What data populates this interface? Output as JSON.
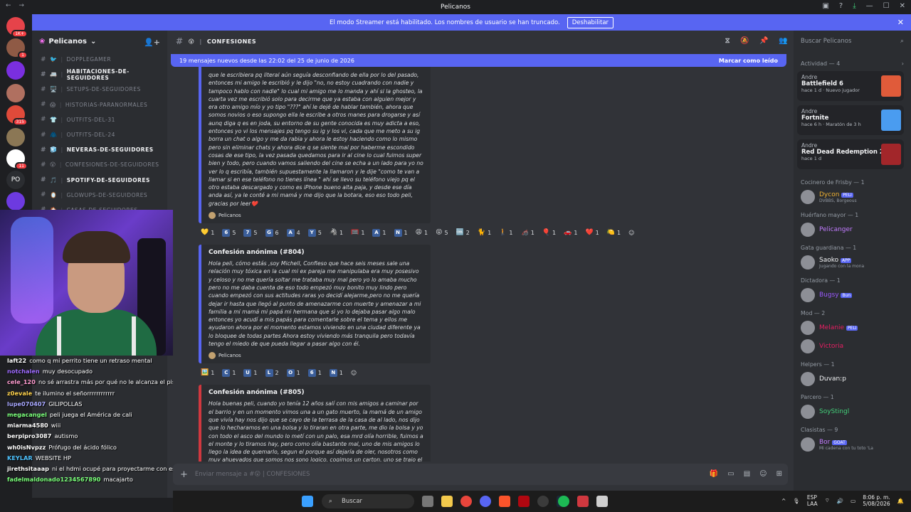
{
  "window": {
    "title": "Pelicanos"
  },
  "banner": {
    "text": "El modo Streamer está habilitado. Los nombres de usuario se han truncado.",
    "button": "Deshabilitar"
  },
  "servers": [
    {
      "label": "",
      "badge": "1K+",
      "color": "#e6434a"
    },
    {
      "label": "",
      "badge": "1",
      "color": "#8f5a45"
    },
    {
      "label": "",
      "badge": "",
      "color": "#7a2fe0"
    },
    {
      "label": "",
      "badge": "",
      "color": "#b07060"
    },
    {
      "label": "",
      "badge": "315",
      "color": "#e04a3a"
    },
    {
      "label": "",
      "badge": "",
      "color": "#8b7755"
    },
    {
      "label": "",
      "badge": "11",
      "color": "#ffffff"
    },
    {
      "label": "PO",
      "badge": "",
      "color": "#2b2d31"
    },
    {
      "label": "",
      "badge": "",
      "color": "#6d3ae0"
    }
  ],
  "guild": {
    "name": "Pelicanos"
  },
  "channels": [
    {
      "emoji": "🐦",
      "name": "DOPPLEGAMER",
      "unread": false
    },
    {
      "emoji": "🚐",
      "name": "HABITACIONES-DE-SEGUIDORES",
      "unread": true
    },
    {
      "emoji": "🖥️",
      "name": "SETUPS-DE-SEGUIDORES",
      "unread": false
    },
    {
      "emoji": "😱",
      "name": "HISTORIAS-PARANORMALES",
      "unread": false
    },
    {
      "emoji": "👕",
      "name": "OUTFITS-DEL-31",
      "unread": false
    },
    {
      "emoji": "🧥",
      "name": "OUTFITS-DEL-24",
      "unread": false
    },
    {
      "emoji": "🧊",
      "name": "NEVERAS-DE-SEGUIDORES",
      "unread": true
    },
    {
      "emoji": "😲",
      "name": "CONFESIONES-DE-SEGUIDORES",
      "unread": false
    },
    {
      "emoji": "🎵",
      "name": "SPOTIFY-DE-SEGUIDORES",
      "unread": true
    },
    {
      "emoji": "🪞",
      "name": "GLOWUPS-DE-SEGUIDORES",
      "unread": false
    },
    {
      "emoji": "🏠",
      "name": "CASAS-DE-SEGUIDORES",
      "unread": false
    }
  ],
  "chat_overlay": [
    {
      "user": "laft22",
      "color": "#ffffff",
      "text": "como q mi perrito tiene un retraso mental"
    },
    {
      "user": "notchalen",
      "color": "#9e6bff",
      "text": "muy desocupado"
    },
    {
      "user": "cele_120",
      "color": "#ff9cd0",
      "text": "no sé arrastra más por qué no le alcanza el piso"
    },
    {
      "user": "z0evale",
      "color": "#ffd34d",
      "text": "te ilumino el señorrrrrrrrrrrr"
    },
    {
      "user": "lupe070407",
      "color": "#a8a8ff",
      "text": "GILIPOLLAS"
    },
    {
      "user": "megacangel",
      "color": "#7bff7b",
      "text": "peli juega el América de cali"
    },
    {
      "user": "miarma4580",
      "color": "#ffffff",
      "text": "wiii"
    },
    {
      "user": "berpipro3087",
      "color": "#ffffff",
      "text": "autismo"
    },
    {
      "user": "wh0isNvpzz",
      "color": "#ffffff",
      "text": "Prófugo del ácido fólico"
    },
    {
      "user": "KEYLAR",
      "color": "#4fc3ff",
      "text": "WEBSITE HP"
    },
    {
      "user": "jirethsitaaap",
      "color": "#ffffff",
      "text": "ni el hdmi ocupé para proyectarme con esa JAJAJAJ"
    },
    {
      "user": "fadelmaldonado1234567890",
      "color": "#7bff7b",
      "text": "macajarto"
    }
  ],
  "channel": {
    "emoji": "😲",
    "name": "CONFESIONES"
  },
  "newbar": {
    "text": "19 mensajes nuevos desde las 22:02 del 25 de junio de 2026",
    "action": "Marcar como leído"
  },
  "embeds": [
    {
      "title": "",
      "body": "que le escribiera pq literal aún seguía desconfiando de ella por lo del pasado, entonces mi amigo le escribió y le dijo \"no, no estoy cuadrando con nadie y tampoco hablo con nadie\" lo cual mi amigo me lo manda y ahí si la ghosteo, la cuarta vez me escribió solo para decirme que ya estaba con alguien mejor y era otro amigo mío y yo tipo \"???\" ahí le dejé de hablar también, ahora que somos novios o eso supongo ella le escribe a otros manes para drogarse y así aunq diga q es en joda, su entorno de su gente conocida es muy adicta a eso, entonces yo vi los mensajes pq tengo su ig y los vi, cada que me meto a su ig borra un chat o algo y me da rabia y ahora le estoy haciendo como lo mismo pero sin eliminar chats y ahora dice q se siente mal por haberme escondido cosas de ese tipo, la vez pasada quedamos para ir al cine lo cual fuimos super bien y todo, pero cuando vamos saliendo del cine se echa a un lado para yo no ver lo q escribía, también supuestamente la llamaron y le dije \"como te van a llamar si en ese teléfono no tienes línea \" ahí se llevo su teléfono viejo pq el otro estaba descargado y como es iPhone bueno alta paja, y desde ese día anda así, ya le conté a mi mamá y me dijo que la botara, eso eso todo peli, gracias por leer❤️",
      "footer": "Pelicanos",
      "red": false
    },
    {
      "title": "Confesión anónima (#804)",
      "body": "Hola peli, cómo estás ,soy Michell, Confieso que hace seis meses sale una relación muy tóxica en la cual mi ex pareja me manipulaba era muy posesivo y celoso y no me quería soltar me trataba muy mal pero yo lo amaba mucho pero no me daba cuenta de eso todo empezó muy bonito muy lindo pero cuando empezó con sus actitudes raras yo decidí alejarme,pero no me quería dejar ir hasta que llegó al punto de amenazarme con muerte y amenazar a mi familia a mi mamá mi papá mi hermana que si yo lo dejaba pasar algo malo entonces yo acudí a mis papás para comentarle sobre el tema y ellos me ayudaron ahora por el momento estamos viviendo en una ciudad diferente ya lo bloquee de todas partes Ahora estoy viviendo más tranquila pero todavía tengo el miedo de que pueda llegar a pasar algo con él.",
      "footer": "Pelicanos",
      "red": false
    },
    {
      "title": "Confesión anónima (#805)",
      "body": "Hola buenas peli, cuando yo tenía 12 años salí con mis amigos a caminar por el barrio y en un momento vimos una a un gato muerto, la mamá de un amigo que vivía hay nos dijo que se cayo de la terrasa de la casa de al lado, nos dijo que lo hecharamos en una bolsa y lo tiraran en otra parte, me dio la bolsa y yo con todo el asco del mundo lo metí con un palo, esa mrd olía horrible, fuimos a el monte y lo tiramos hay, pero como olía bastante mal, uno de mis amigos lo llego la idea de quemarlo, segun el porque así dejaría de oler, nosotros como muy ahuevados que somos nos sono logico, cogimos un carton, uno se trajo el encendedor he",
      "footer": "",
      "red": true
    }
  ],
  "reactions_1": [
    {
      "e": "💛",
      "n": "1"
    },
    {
      "b": "6",
      "n": "5"
    },
    {
      "b": "7",
      "n": "5"
    },
    {
      "b": "G",
      "n": "6"
    },
    {
      "b": "A",
      "n": "4"
    },
    {
      "b": "Y",
      "n": "5"
    },
    {
      "e": "🦓",
      "n": "1"
    },
    {
      "e": "🥅",
      "n": "1"
    },
    {
      "b": "A",
      "n": "1"
    },
    {
      "b": "N",
      "n": "1"
    },
    {
      "e": "😩",
      "n": "1"
    },
    {
      "e": "😝",
      "n": "5"
    },
    {
      "e": "🆒",
      "n": "2"
    },
    {
      "e": "🐈",
      "n": "1"
    },
    {
      "e": "🚶",
      "n": "1"
    },
    {
      "e": "🦽",
      "n": "1"
    },
    {
      "e": "🎈",
      "n": "1"
    },
    {
      "e": "🚗",
      "n": "1"
    },
    {
      "e": "❤️",
      "n": "1"
    },
    {
      "e": "🍋",
      "n": "1"
    }
  ],
  "reactions_2": [
    {
      "e": "🖼️",
      "n": "1"
    },
    {
      "b": "C",
      "n": "1"
    },
    {
      "b": "U",
      "n": "1"
    },
    {
      "b": "L",
      "n": "2"
    },
    {
      "b": "O",
      "n": "1"
    },
    {
      "b": "6",
      "n": "1"
    },
    {
      "b": "N",
      "n": "1"
    }
  ],
  "composer": {
    "placeholder": "Enviar mensaje a #😲 | CONFESIONES"
  },
  "members_search": "Buscar Pelicanos",
  "activity": {
    "header": "Actividad — 4",
    "cards": [
      {
        "user": "Andre",
        "game": "Battlefield 6",
        "meta": "hace 1 d · Nuevo jugador",
        "color": "#e05b3a"
      },
      {
        "user": "Andre",
        "game": "Fortnite",
        "meta": "hace 6 h · Maratón de 3 h",
        "color": "#4a9cf0"
      },
      {
        "user": "Andre",
        "game": "Red Dead Redemption 2",
        "meta": "hace 1 d",
        "color": "#a2262a"
      }
    ]
  },
  "roles": [
    {
      "name": "Cocinero de Frisby — 1",
      "members": [
        {
          "name": "Dycon",
          "tag": "PELI",
          "sub": "DVBBS, Borgeous",
          "color": "#f0b232"
        }
      ]
    },
    {
      "name": "Huérfano mayor — 1",
      "members": [
        {
          "name": "Pelicanger",
          "tag": "",
          "sub": "",
          "color": "#c27cff"
        }
      ]
    },
    {
      "name": "Gata guardiana — 1",
      "members": [
        {
          "name": "Saoko",
          "tag": "APP",
          "sub": "Jugando con la mona",
          "color": "#f2f3f5"
        }
      ]
    },
    {
      "name": "Dictadora — 1",
      "members": [
        {
          "name": "Bugsy",
          "tag": "Bun",
          "sub": "",
          "color": "#9b59ff"
        }
      ]
    },
    {
      "name": "Mod — 2",
      "members": [
        {
          "name": "Melanie",
          "tag": "PELI",
          "sub": "",
          "color": "#e91e63"
        },
        {
          "name": "Victoria",
          "tag": "",
          "sub": "",
          "color": "#e91e63"
        }
      ]
    },
    {
      "name": "Helpers — 1",
      "members": [
        {
          "name": "Duvan:p",
          "tag": "",
          "sub": "",
          "color": "#f2f3f5"
        }
      ]
    },
    {
      "name": "Parcero — 1",
      "members": [
        {
          "name": "SoyStingl",
          "tag": "",
          "sub": "",
          "color": "#43d17a"
        }
      ]
    },
    {
      "name": "Clasistas — 9",
      "members": [
        {
          "name": "Bor",
          "tag": "GOAT",
          "sub": "Mi cadena con tu toto 'La",
          "color": "#c27cff"
        }
      ]
    }
  ],
  "taskbar": {
    "search": "Buscar",
    "lang": "ESP",
    "lang2": "LAA",
    "time": "8:06 p. m.",
    "date": "5/08/2026"
  }
}
